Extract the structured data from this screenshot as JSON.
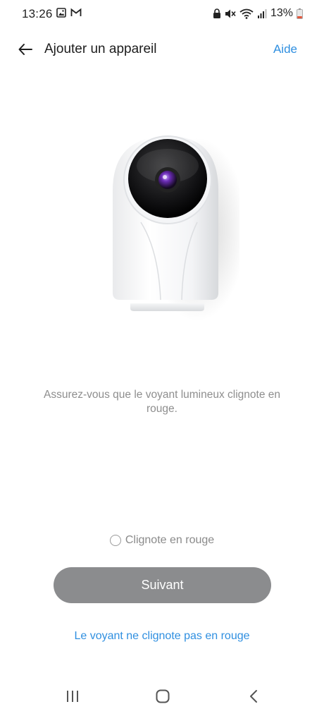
{
  "status_bar": {
    "time": "13:26",
    "left_icons": [
      "image-icon",
      "gmail-icon"
    ],
    "right_icons": [
      "lock-icon",
      "mute-icon",
      "wifi-icon",
      "signal-icon",
      "battery-icon"
    ],
    "battery": "13%",
    "battery_color": "#e2553a"
  },
  "header": {
    "title": "Ajouter un appareil",
    "help_label": "Aide"
  },
  "main": {
    "instruction": "Assurez-vous que le voyant lumineux clignote en rouge.",
    "checkbox_label": "Clignote en rouge",
    "checkbox_checked": false,
    "next_label": "Suivant",
    "alt_link_label": "Le voyant ne clignote pas en rouge"
  },
  "colors": {
    "accent": "#2f8fe0",
    "button_disabled": "#8b8c8e"
  },
  "nav_bar": {
    "buttons": [
      "recent-apps-icon",
      "home-icon",
      "back-icon"
    ]
  }
}
